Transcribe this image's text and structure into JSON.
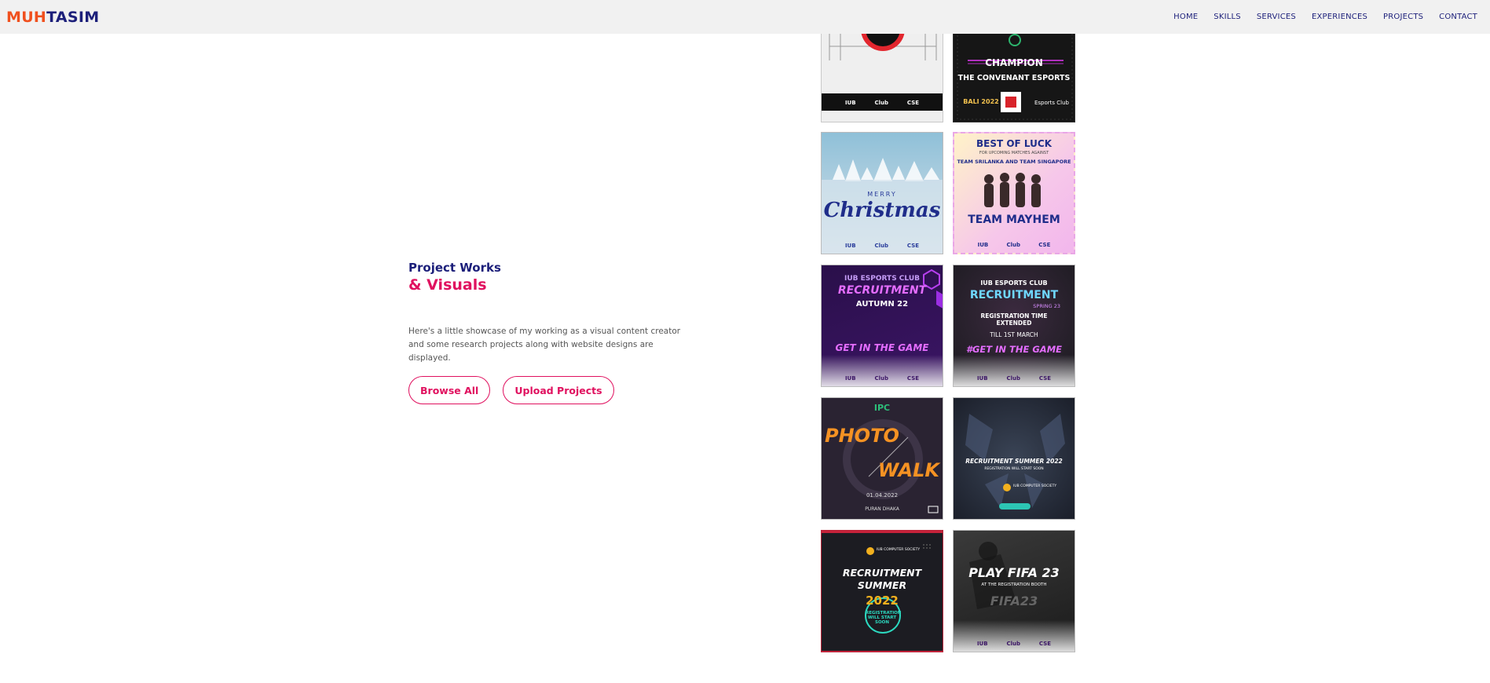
{
  "nav": {
    "brand_part1": "MUH",
    "brand_part2": "TASIM",
    "links": [
      "HOME",
      "SKILLS",
      "SERVICES",
      "EXPERIENCES",
      "PROJECTS",
      "CONTACT"
    ]
  },
  "hero": {
    "kicker": "Project Works",
    "headline": "& Visuals",
    "description": "Here's a little showcase of my working as a visual content creator and some research projects along with website designs are displayed.",
    "browse_label": "Browse All",
    "upload_label": "Upload Projects"
  },
  "gallery": {
    "t1": {
      "logos": [
        "IUB",
        "Club",
        "CSE"
      ]
    },
    "t2": {
      "title": "CHAMPION",
      "subtitle": "THE CONVENANT ESPORTS",
      "badge": "BALI 2022",
      "club": "Esports Club"
    },
    "t3": {
      "title_small": "MERRY",
      "title_script": "Christmas",
      "logos": [
        "IUB",
        "Club",
        "CSE"
      ]
    },
    "t4": {
      "title": "BEST OF LUCK",
      "small": "FOR UPCOMING MATCHES AGAINST",
      "teams": "TEAM SRILANKA AND TEAM SINGAPORE",
      "name": "TEAM MAYHEM",
      "logos": [
        "IUB",
        "Club",
        "CSE"
      ]
    },
    "t5": {
      "club": "IUB ESPORTS CLUB",
      "title": "RECRUITMENT",
      "season": "AUTUMN 22",
      "cta": "GET IN THE GAME",
      "logos": [
        "IUB",
        "Club",
        "CSE"
      ]
    },
    "t6": {
      "club": "IUB ESPORTS CLUB",
      "title": "RECRUITMENT",
      "season": "SPRING 23",
      "line1": "REGISTRATION TIME EXTENDED",
      "line2": "TILL 1ST MARCH",
      "cta": "#GET IN THE GAME",
      "logos": [
        "IUB",
        "Club",
        "CSE"
      ]
    },
    "t7": {
      "org": "IPC",
      "title1": "PHOTO",
      "title2": "WALK",
      "date": "01.04.2022",
      "place": "PURAN DHAKA"
    },
    "t8": {
      "title": "RECRUITMENT SUMMER 2022",
      "sub": "REGISTRATION WILL START SOON",
      "org": "IUB COMPUTER SOCIETY"
    },
    "t9": {
      "org": "IUB COMPUTER SOCIETY",
      "title1": "RECRUITMENT",
      "title2": "SUMMER",
      "year": "2022",
      "sub": "REGISTRATION WILL START SOON"
    },
    "t10": {
      "title": "PLAY FIFA 23",
      "sub": "AT THE REGISTRATION BOOTH",
      "game": "FIFA23",
      "logos": [
        "IUB",
        "Club",
        "CSE"
      ]
    }
  }
}
